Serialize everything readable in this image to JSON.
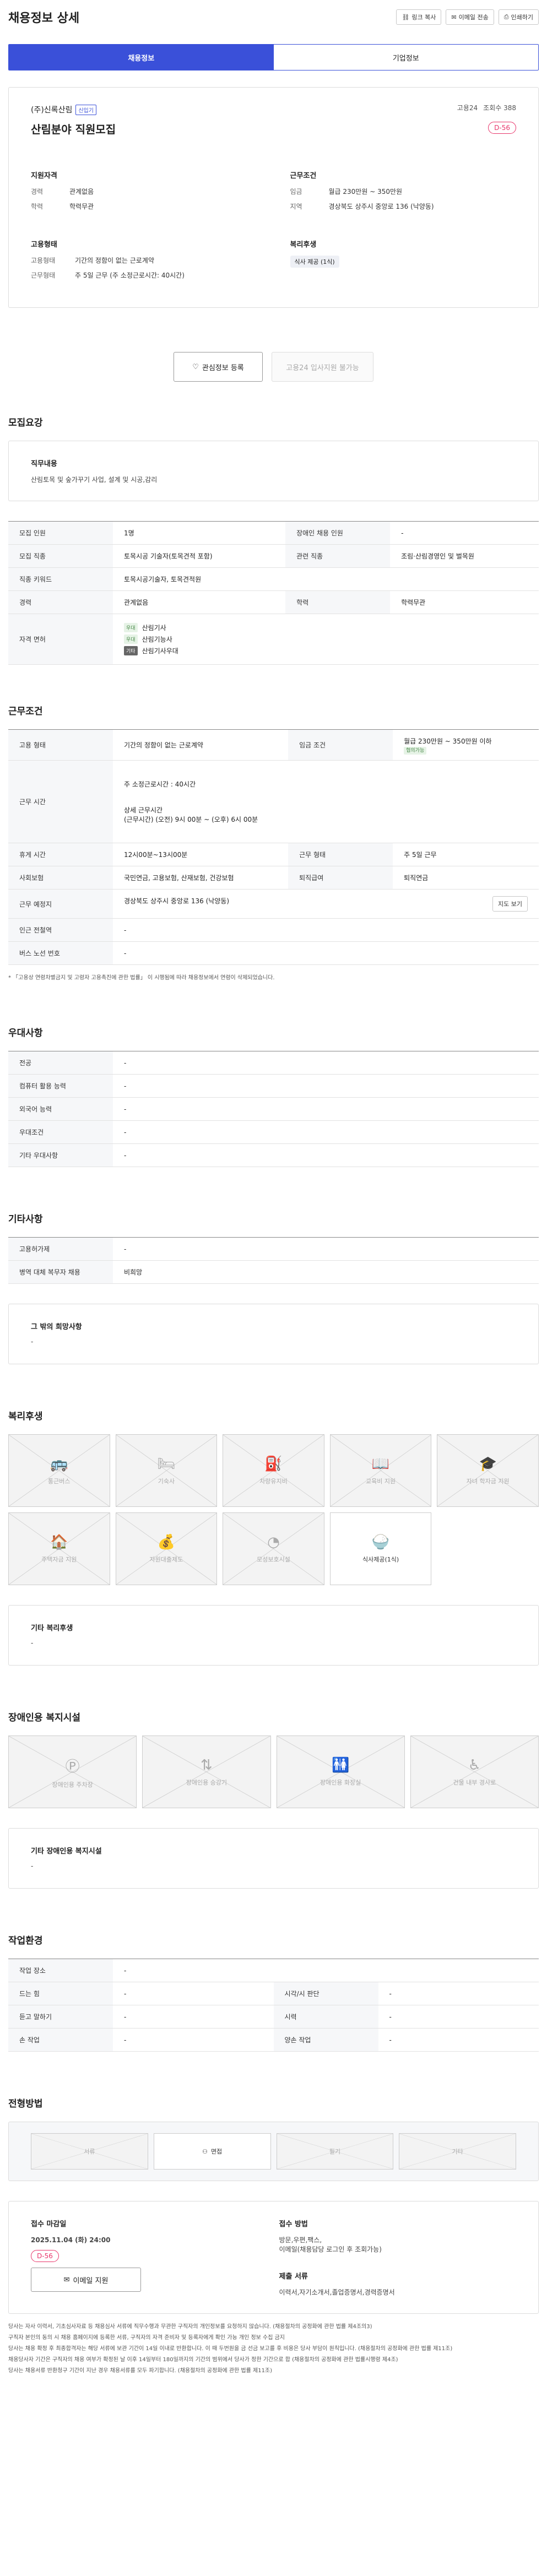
{
  "header": {
    "title": "채용정보 상세",
    "tools": [
      "링크 복사",
      "이메일 전송",
      "인쇄하기"
    ]
  },
  "tabs": [
    "채용정보",
    "기업정보"
  ],
  "summary": {
    "company": "(주)신록산림",
    "badge": "신입기",
    "views_label": "고용24",
    "views": "조회수 388",
    "title": "산림분야 직원모집",
    "dday": "D-56",
    "qual": {
      "h": "지원자격",
      "rows": [
        [
          "경력",
          "관계없음"
        ],
        [
          "학력",
          "학력무관"
        ]
      ]
    },
    "cond": {
      "h": "근무조건",
      "rows": [
        [
          "임금",
          "월급 230만원 ~ 350만원"
        ],
        [
          "지역",
          "경상북도 상주시 중앙로 136 (낙양동)"
        ]
      ]
    },
    "emp": {
      "h": "고용형태",
      "rows": [
        [
          "고용형태",
          "기간의 정함이 없는 근로계약"
        ],
        [
          "근무형태",
          "주 5일 근무 (주 소정근로시간: 40시간)"
        ]
      ]
    },
    "welfare": {
      "h": "복리후생",
      "chip": "식사 제공 (1식)"
    }
  },
  "actions": {
    "interest": "관심정보 등록",
    "apply": "고용24 입사지원 불가능"
  },
  "recruit": {
    "h": "모집요강",
    "job_h": "직무내용",
    "job": "산림토목 및 숲가꾸기 사업, 설계 및 시공,감리",
    "rows": [
      [
        "모집 인원",
        "1명",
        "장애인 채용 인원",
        "-"
      ],
      [
        "모집 직종",
        "토목시공 기술자(토목견적 포함)",
        "관련 직종",
        "조림·산림경영인 및 벌목원"
      ],
      [
        "직종 키워드",
        "토목시공기술자, 토목견적원"
      ],
      [
        "경력",
        "관계없음",
        "학력",
        "학력무관"
      ]
    ],
    "license_h": "자격 면허",
    "licenses": [
      [
        "우대",
        "산림기사"
      ],
      [
        "우대",
        "산림기능사"
      ],
      [
        "기타",
        "산림기사우대"
      ]
    ]
  },
  "work": {
    "h": "근무조건",
    "rows": [
      [
        "고용 형태",
        "기간의 정함이 없는 근로계약",
        "임금 조건",
        "월급 230만원 ~ 350만원 이하"
      ],
      [
        "근무 시간",
        "주 소정근로시간 : 40시간",
        "상세 근무시간",
        "(근무시간) (오전) 9시 00분 ~ (오후) 6시 00분"
      ],
      [
        "휴게 시간",
        "12시00분~13시00분",
        "근무 형태",
        "주 5일 근무"
      ],
      [
        "사회보험",
        "국민연금, 고용보험, 산재보험, 건강보험",
        "퇴직급여",
        "퇴직연금"
      ],
      [
        "근무 예정지",
        "경상북도 상주시 중앙로 136 (낙양동)"
      ],
      [
        "인근 전철역",
        "-"
      ],
      [
        "버스 노선 번호",
        "-"
      ]
    ],
    "badge": "협의가능",
    "map": "지도 보기",
    "note": "* 「고용상 연령차별금지 및 고령자 고용촉진에 관한 법률」 이 시행됨에 따라 채용정보에서 연령이 삭제되었습니다."
  },
  "pref": {
    "h": "우대사항",
    "rows": [
      [
        "전공",
        "-"
      ],
      [
        "컴퓨터 활용 능력",
        "-"
      ],
      [
        "외국어 능력",
        "-"
      ],
      [
        "우대조건",
        "-"
      ],
      [
        "기타 우대사항",
        "-"
      ]
    ]
  },
  "etc": {
    "h": "기타사항",
    "rows": [
      [
        "고용허가제",
        "-"
      ],
      [
        "병역 대체 복무자 채용",
        "비희망"
      ],
      [
        "",
        "-"
      ]
    ],
    "other_h": "그 밖의 희망사항",
    "other": "-"
  },
  "benefits": {
    "h": "복리후생",
    "items": [
      "통근버스",
      "기숙사",
      "차량유지비",
      "교육비 지원",
      "자녀 학자금 지원",
      "주택자금 지원",
      "자원대출제도",
      "모성보호시설",
      "식사제공(1식)"
    ],
    "other_h": "기타 복리후생",
    "other": "-"
  },
  "disabled": {
    "h": "장애인용 복지시설",
    "items": [
      "장애인용 주차장",
      "장애인용 승강기",
      "장애인용 화장실",
      "건물 내부 경사로"
    ],
    "other_h": "기타 장애인용 복지시설",
    "other": "-"
  },
  "env": {
    "h": "작업환경",
    "rows": [
      [
        "작업 장소",
        "-",
        "",
        ""
      ],
      [
        "드는 힘",
        "-",
        "시각/시 판단",
        "-"
      ],
      [
        "듣고 말하기",
        "-",
        "시력",
        "-"
      ],
      [
        "손 작업",
        "-",
        "양손 작업",
        "-"
      ]
    ]
  },
  "method": {
    "h": "전형방법",
    "items": [
      "서류",
      "면접",
      "필기",
      "기타"
    ]
  },
  "receipt": {
    "deadline_h": "접수 마감일",
    "deadline": "2025.11.04 (화) 24:00",
    "dday": "D-56",
    "email": "이메일 지원",
    "method_h": "접수 방법",
    "method": "방문,우편,팩스,",
    "method2": "이메일(채용담당 로그인 후 조회가능)",
    "docs_h": "제출 서류",
    "docs": "이력서,자기소개서,졸업증명서,경력증명서"
  },
  "notes": [
    "당사는 자사 이력서, 기초심사자료 등 채용심사 서류에 직무수행과 무관한 구직자의 개인정보를 요청하지 않습니다. (채용절차의 공정화에 관한 법률 제4조의3)",
    "구직자 본인의 동의 시 채용 홈페이지에 등록한 서류, 구직자의 자격 준비자 및 등록자에게 확인 가능 개인 정보 수집 금지",
    "당사는 채용 확정 후 최종합격자는 해당 서류에 보관 기간이 14일 이내로 반환합니다. 이 때 두번원을 금 선금 보고를 후 비용은 당사 부담이 원칙입니다. (채용절차의 공정화에 관한 법률 제11조)",
    "채용당사자 기간은 구직자의 채용 여부가 확정된 날 이후 14일부터 180일까지의 기간의 범위에서 당사가 정한 기간으로 합 (채용절차의 공정화에 관한 법률시행령 제4조)",
    "당사는 채용서류 반환청구 기간이 지난 경우 채용서류를 모두 파기합니다. (채용절차의 공정화에 관한 법률 제11조)"
  ]
}
